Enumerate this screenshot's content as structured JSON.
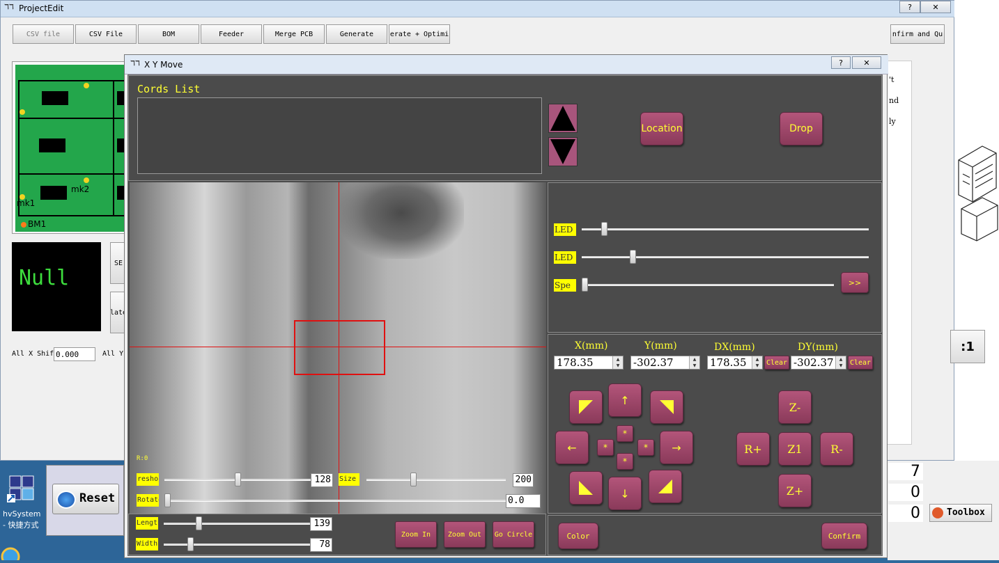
{
  "project_window": {
    "title": "ProjectEdit",
    "toolbar": [
      "CSV file",
      "CSV File",
      "BOM",
      "Feeder",
      "Merge PCB",
      "Generate",
      "erate + Optimi",
      "nfirm and Qu"
    ],
    "pcb_labels": {
      "mk1": "mk1",
      "mk2": "mk2",
      "bm": "BM1"
    },
    "null_text": "Null",
    "side_buttons": [
      "SE",
      "late"
    ],
    "all_x_shift_label": "All X Shif",
    "all_x_shift_value": "0.000",
    "all_y_label": "All Y",
    "right_texts": [
      "'t",
      "nd",
      "ly"
    ],
    "ratio_label": ":1",
    "counters": [
      "7",
      "0",
      "0"
    ],
    "toolbox_label": "Toolbox",
    "reset_label": "Reset",
    "desktop_icon_label": "hvSystem",
    "desktop_icon_label2": "- 快捷方式"
  },
  "dialog": {
    "title": "X Y Move",
    "cords_list_label": "Cords List",
    "location_button": "Location",
    "drop_button": "Drop",
    "camera": {
      "r_label": "R:0",
      "threshold_label": "reshol",
      "threshold_value": "128",
      "size_label": "Size",
      "size_value": "200",
      "rotate_label": "Rotate",
      "rotate_value": "0.0",
      "length_label": "Length",
      "length_value": "139",
      "width_label": "Width",
      "width_value": "78",
      "sliders": {
        "threshold": 0.5,
        "size": 0.33,
        "rotate": 0.0,
        "length": 0.23,
        "width": 0.17
      }
    },
    "zoom_in": "Zoom In",
    "zoom_out": "Zoom Out",
    "go_circle": "Go Circle",
    "light": {
      "led1_label": "LED",
      "led2_label": "LED",
      "speed_label": "Spe",
      "more_button": ">>",
      "sliders": {
        "led1": 0.07,
        "led2": 0.17,
        "speed": 0.0
      }
    },
    "coords": {
      "x_label": "X(mm)",
      "y_label": "Y(mm)",
      "dx_label": "DX(mm)",
      "dy_label": "DY(mm)",
      "x_value": "178.35",
      "y_value": "-302.37",
      "dx_value": "178.35",
      "dy_value": "-302.37",
      "clear": "Clear"
    },
    "jog": {
      "up": "↑",
      "down": "↓",
      "left": "←",
      "right": "→",
      "star": "*",
      "z_minus": "Z-",
      "z_plus": "Z+",
      "z1": "Z1",
      "r_plus": "R+",
      "r_minus": "R-"
    },
    "color_button": "Color",
    "confirm_button": "Confirm"
  },
  "colors": {
    "accent": "#9c4868",
    "label_yellow": "#ffff00",
    "panel": "#4b4b4b",
    "pcb_green": "#23a64b"
  }
}
